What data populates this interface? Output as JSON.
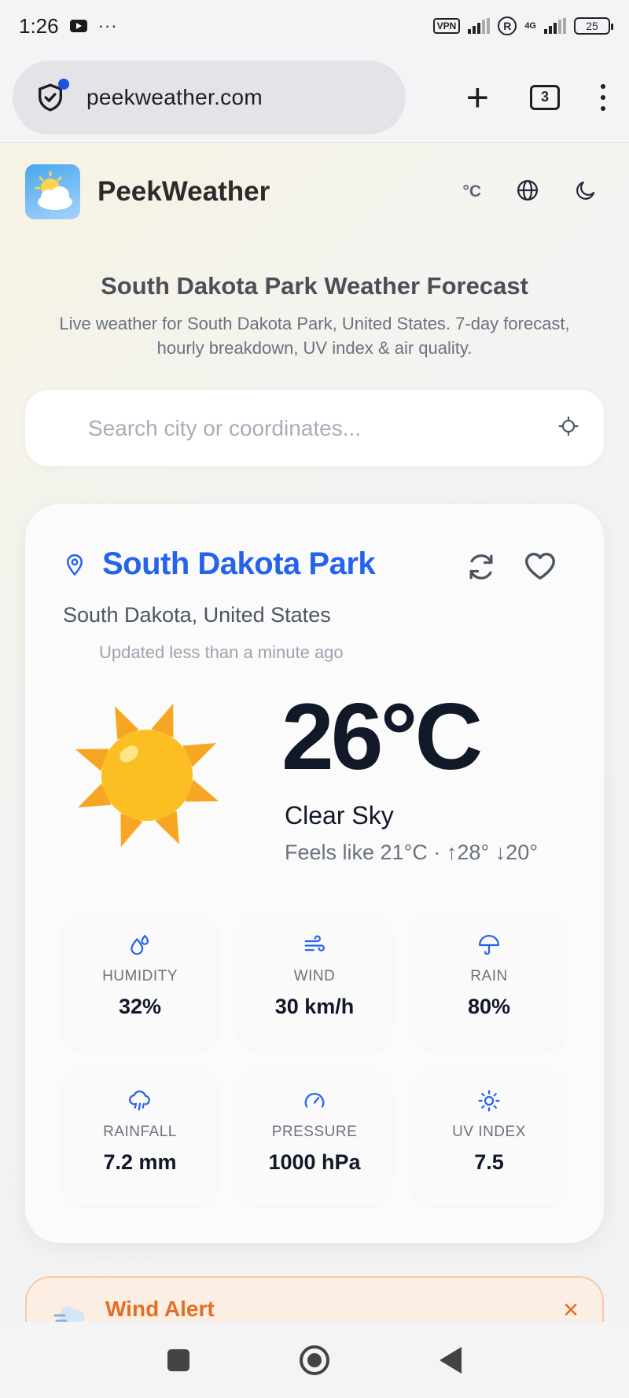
{
  "status_bar": {
    "time": "1:26",
    "vpn": "VPN",
    "network": "4G",
    "battery": "25"
  },
  "browser": {
    "url": "peekweather.com",
    "tab_count": "3"
  },
  "site": {
    "brand": "PeekWeather",
    "unit_toggle": "°C",
    "title": "South Dakota Park Weather Forecast",
    "subtitle": "Live weather for South Dakota Park, United States. 7-day forecast, hourly breakdown, UV index & air quality.",
    "search_placeholder": "Search city or coordinates..."
  },
  "weather": {
    "location": "South Dakota Park",
    "region": "South Dakota,  United States",
    "updated": "Updated less than a minute ago",
    "temperature": "26°C",
    "condition": "Clear Sky",
    "feels_like": "Feels like 21°C · ↑28° ↓20°",
    "stats": [
      {
        "label": "HUMIDITY",
        "value": "32%",
        "icon": "humidity-icon"
      },
      {
        "label": "WIND",
        "value": "30 km/h",
        "icon": "wind-icon"
      },
      {
        "label": "RAIN",
        "value": "80%",
        "icon": "umbrella-icon"
      },
      {
        "label": "RAINFALL",
        "value": "7.2 mm",
        "icon": "rain-cloud-icon"
      },
      {
        "label": "PRESSURE",
        "value": "1000 hPa",
        "icon": "gauge-icon"
      },
      {
        "label": "UV INDEX",
        "value": "7.5",
        "icon": "sun-small-icon"
      }
    ]
  },
  "alert": {
    "title": "Wind Alert",
    "close": "×"
  },
  "colors": {
    "accent": "#2563eb",
    "alert": "#e26f24",
    "sun": "#fbbf24"
  }
}
